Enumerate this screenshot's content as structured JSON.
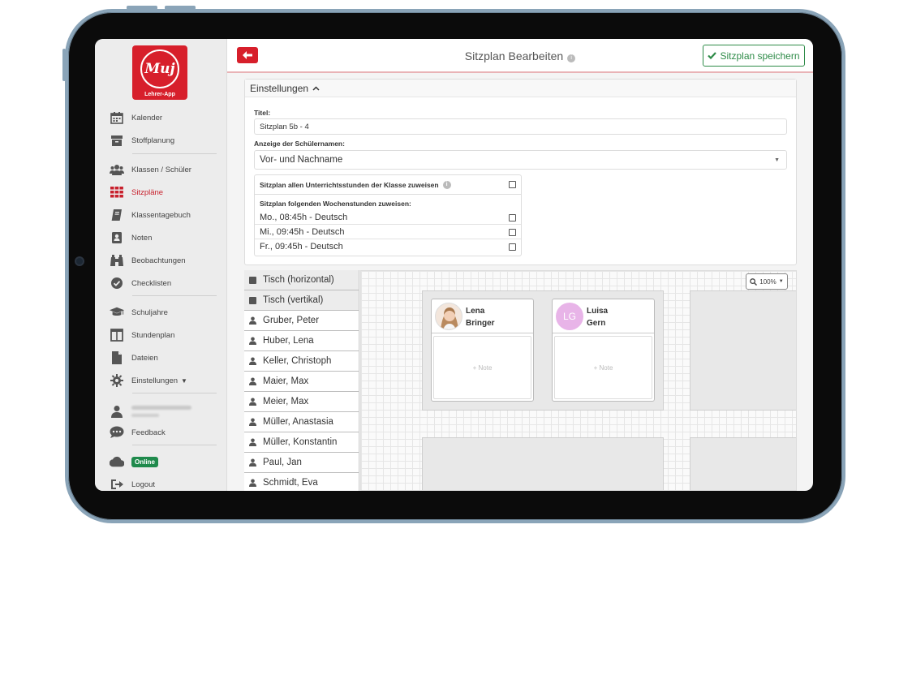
{
  "sidebar": {
    "logo_text": "Lehrer-App",
    "logo_mark": "Muj",
    "items": [
      {
        "label": "Kalender",
        "icon": "calendar-icon"
      },
      {
        "label": "Stoffplanung",
        "icon": "archive-icon"
      },
      {
        "label": "Klassen / Schüler",
        "icon": "users-icon"
      },
      {
        "label": "Sitzpläne",
        "icon": "grid-icon"
      },
      {
        "label": "Klassentagebuch",
        "icon": "book-icon"
      },
      {
        "label": "Noten",
        "icon": "grade-book-icon"
      },
      {
        "label": "Beobachtungen",
        "icon": "binoculars-icon"
      },
      {
        "label": "Checklisten",
        "icon": "check-circle-icon"
      },
      {
        "label": "Schuljahre",
        "icon": "graduation-cap-icon"
      },
      {
        "label": "Stundenplan",
        "icon": "timetable-icon"
      },
      {
        "label": "Dateien",
        "icon": "file-icon"
      },
      {
        "label": "Einstellungen",
        "icon": "gear-icon"
      },
      {
        "label": "Feedback",
        "icon": "chat-icon"
      },
      {
        "label": "Online",
        "icon": "cloud-icon"
      },
      {
        "label": "Logout",
        "icon": "logout-icon"
      }
    ],
    "active_color": "#c8202c"
  },
  "header": {
    "title": "Sitzplan Bearbeiten",
    "save_label": "Sitzplan speichern"
  },
  "settings": {
    "heading": "Einstellungen",
    "title_label": "Titel:",
    "title_value": "Sitzplan 5b - 4",
    "names_label": "Anzeige der Schülernamen:",
    "names_value": "Vor- und Nachname",
    "assign_all_label": "Sitzplan allen Unterrichtsstunden der Klasse zuweisen",
    "assign_some_label": "Sitzplan folgenden Wochenstunden zuweisen:",
    "lessons": [
      "Mo., 08:45h - Deutsch",
      "Mi., 09:45h - Deutsch",
      "Fr., 09:45h - Deutsch"
    ]
  },
  "list": {
    "tools": [
      "Tisch (horizontal)",
      "Tisch (vertikal)"
    ],
    "students": [
      "Gruber, Peter",
      "Huber, Lena",
      "Keller, Christoph",
      "Maier, Max",
      "Meier, Max",
      "Müller, Anastasia",
      "Müller, Konstantin",
      "Paul, Jan",
      "Schmidt, Eva"
    ]
  },
  "canvas": {
    "zoom": "100%",
    "seats": [
      {
        "first": "Lena",
        "last": "Bringer",
        "note": "+ Note",
        "avatar": "photo"
      },
      {
        "first": "Luisa",
        "last": "Gern",
        "note": "+ Note",
        "initials": "LG"
      }
    ]
  },
  "colors": {
    "brand_red": "#d71f2b",
    "save_green": "#2e8b48",
    "online_green": "#1f8a4c"
  }
}
